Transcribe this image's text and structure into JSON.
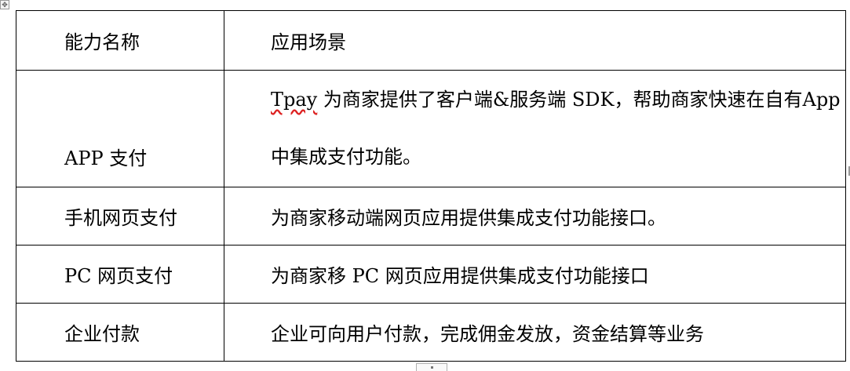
{
  "table": {
    "header": {
      "col1": "能力名称",
      "col2": "应用场景"
    },
    "rows": [
      {
        "name": "APP 支付",
        "desc_word": "Tpay",
        "desc_rest": " 为商家提供了客户端&服务端 SDK，帮助商家快速在自有App 中集成支付功能。"
      },
      {
        "name": "手机网页支付",
        "desc": "为商家移动端网页应用提供集成支付功能接口。"
      },
      {
        "name": "PC 网页支付",
        "desc": "为商家移 PC 网页应用提供集成支付功能接口"
      },
      {
        "name": "企业付款",
        "desc": "企业可向用户付款，完成佣金发放，资金结算等业务"
      }
    ]
  },
  "icons": {
    "move_handle": "move-cross-icon",
    "resize_handle": "table-resize-icon"
  }
}
